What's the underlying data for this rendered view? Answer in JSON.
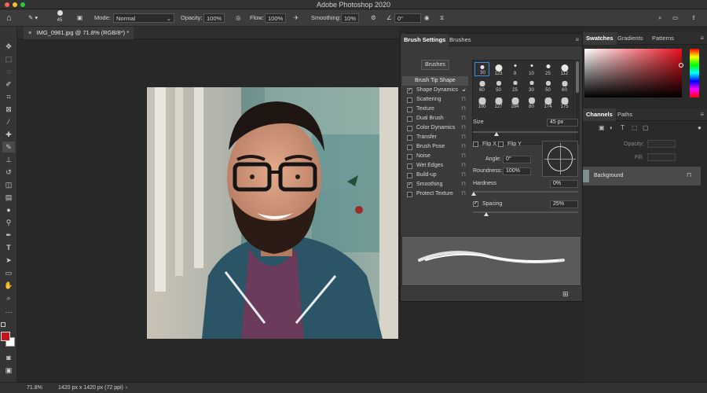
{
  "window": {
    "title": "Adobe Photoshop 2020"
  },
  "options_bar": {
    "brush_size": "45",
    "mode_label": "Mode:",
    "mode_value": "Normal",
    "opacity_label": "Opacity:",
    "opacity_value": "100%",
    "flow_label": "Flow:",
    "flow_value": "100%",
    "smoothing_label": "Smoothing:",
    "smoothing_value": "10%",
    "angle_value": "0°"
  },
  "document": {
    "tab_label": "IMG_0981.jpg @ 71.8% (RGB/8*) *"
  },
  "status": {
    "zoom": "71.8%",
    "doc_info": "1420 px x 1420 px (72 ppi)"
  },
  "brush_panel": {
    "tabs": [
      "Brush Settings",
      "Brushes"
    ],
    "brushes_button": "Brushes",
    "options": [
      {
        "label": "Brush Tip Shape",
        "checked": null
      },
      {
        "label": "Shape Dynamics",
        "checked": true
      },
      {
        "label": "Scattering",
        "checked": false
      },
      {
        "label": "Texture",
        "checked": false
      },
      {
        "label": "Dual Brush",
        "checked": false
      },
      {
        "label": "Color Dynamics",
        "checked": false
      },
      {
        "label": "Transfer",
        "checked": false
      },
      {
        "label": "Brush Pose",
        "checked": false
      },
      {
        "label": "Noise",
        "checked": false
      },
      {
        "label": "Wet Edges",
        "checked": false
      },
      {
        "label": "Build-up",
        "checked": false
      },
      {
        "label": "Smoothing",
        "checked": true
      },
      {
        "label": "Protect Texture",
        "checked": false
      }
    ],
    "tip_sizes": [
      "30",
      "123",
      "8",
      "10",
      "25",
      "112",
      "60",
      "50",
      "25",
      "30",
      "50",
      "60",
      "100",
      "127",
      "284",
      "80",
      "174",
      "175"
    ],
    "size_label": "Size",
    "size_value": "45 px",
    "flip_x": "Flip X",
    "flip_y": "Flip Y",
    "angle_label": "Angle:",
    "angle_value": "0°",
    "roundness_label": "Roundness:",
    "roundness_value": "100%",
    "hardness_label": "Hardness",
    "hardness_value": "0%",
    "spacing_label": "Spacing",
    "spacing_value": "25%"
  },
  "right_panels": {
    "color_tabs": [
      "Swatches",
      "Gradients",
      "Patterns"
    ],
    "layers_tabs": [
      "Channels",
      "Paths"
    ],
    "opacity_label": "Opacity:",
    "fill_label": "Fill:",
    "layer_name": "Background"
  }
}
